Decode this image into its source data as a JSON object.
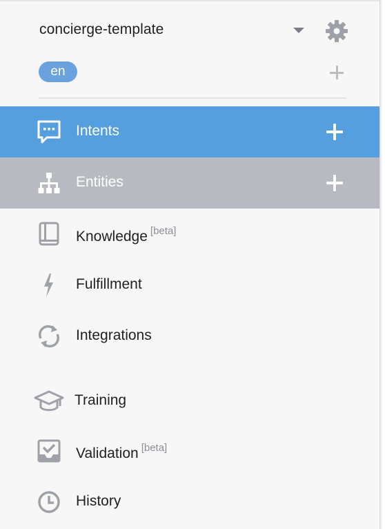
{
  "agent": {
    "name": "concierge-template",
    "dropdown_icon": "caret-down-icon",
    "settings_icon": "gear-icon"
  },
  "language": {
    "current": "en",
    "add_icon": "plus-icon"
  },
  "nav": {
    "items": [
      {
        "id": "intents",
        "label": "Intents",
        "icon": "chat-icon",
        "has_add": true,
        "state": "selected"
      },
      {
        "id": "entities",
        "label": "Entities",
        "icon": "hierarchy-icon",
        "has_add": true,
        "state": "hover"
      },
      {
        "id": "knowledge",
        "label": "Knowledge",
        "badge": "[beta]",
        "icon": "book-icon"
      },
      {
        "id": "fulfillment",
        "label": "Fulfillment",
        "icon": "lightning-icon"
      },
      {
        "id": "integrations",
        "label": "Integrations",
        "icon": "sync-icon"
      },
      {
        "id": "training",
        "label": "Training",
        "icon": "graduation-cap-icon"
      },
      {
        "id": "validation",
        "label": "Validation",
        "badge": "[beta]",
        "icon": "check-box-icon"
      },
      {
        "id": "history",
        "label": "History",
        "icon": "clock-icon"
      }
    ]
  },
  "colors": {
    "selected_bg": "#559fde",
    "hover_bg": "#b8bac2",
    "panel_bg": "#f7f7f7",
    "lang_badge_bg": "#6aa2dd",
    "icon_grey": "#9ea1a7",
    "text": "#202124"
  }
}
